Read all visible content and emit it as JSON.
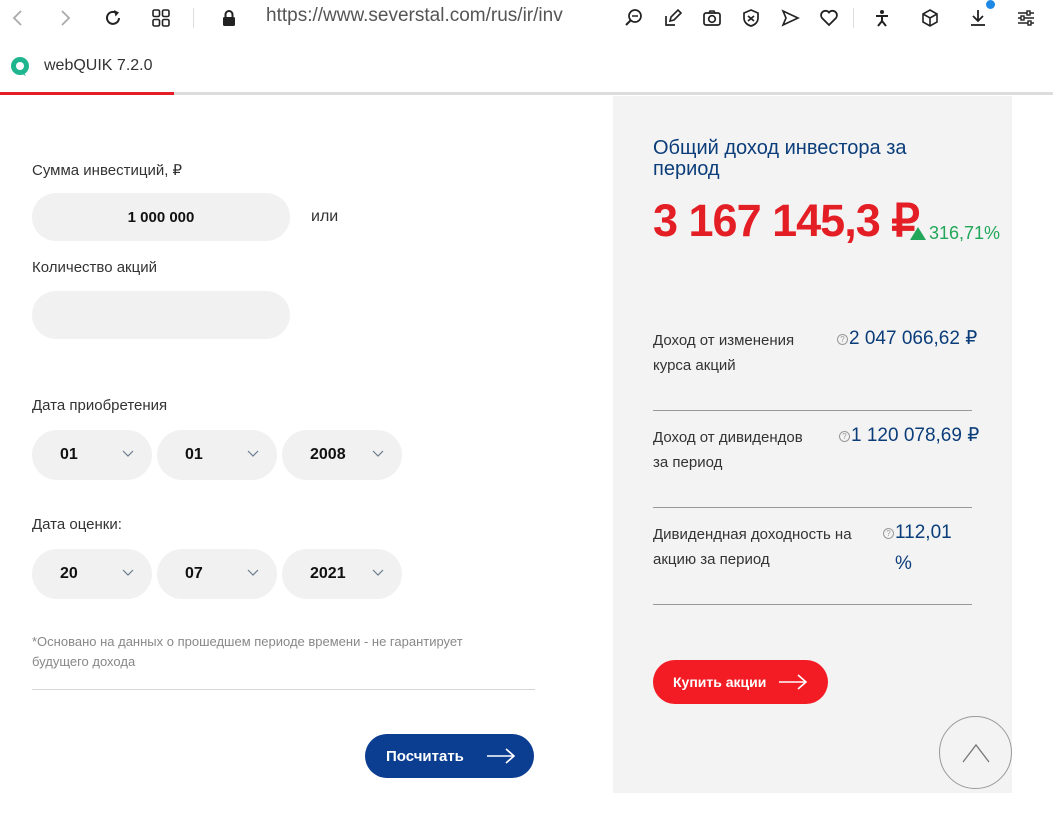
{
  "browser": {
    "url": "https://www.severstal.com/rus/ir/inv",
    "icons": [
      "back-icon",
      "forward-icon",
      "reload-icon",
      "grid-icon",
      "lock-icon",
      "zoom-icon",
      "edit-icon",
      "camera-icon",
      "shield-icon",
      "send-icon",
      "heart-icon",
      "accessibility-icon",
      "cube-icon",
      "download-icon",
      "settings-icon"
    ]
  },
  "quik": {
    "label": "webQUIK 7.2.0",
    "progress": 0.165
  },
  "form": {
    "amount_label": "Сумма инвестиций, ₽",
    "amount_value": "1 000 000",
    "or_text": "или",
    "shares_label": "Количество акций",
    "shares_value": "",
    "purchase_label": "Дата приобретения",
    "purchase": {
      "day": "01",
      "month": "01",
      "year": "2008"
    },
    "eval_label": "Дата оценки:",
    "eval": {
      "day": "20",
      "month": "07",
      "year": "2021"
    },
    "note": "*Основано на данных о прошедшем периоде времени - не гарантирует будущего дохода",
    "calc_button": "Посчитать"
  },
  "result": {
    "title": "Общий доход инвестора за период",
    "total": "3 167 145,3 ₽",
    "percent": "316,71%",
    "rows": [
      {
        "label": "Доход от изменения курса акций",
        "value": "2 047 066,62 ₽"
      },
      {
        "label": "Доход от дивидендов за период",
        "value": "1 120 078,69 ₽"
      },
      {
        "label": "Дивидендная доходность на акцию за период",
        "value": "112,01 %"
      }
    ],
    "buy_button": "Купить акции"
  },
  "colors": {
    "accent_red": "#e31e24",
    "brand_blue": "#0b3d91",
    "positive": "#22a65a"
  }
}
